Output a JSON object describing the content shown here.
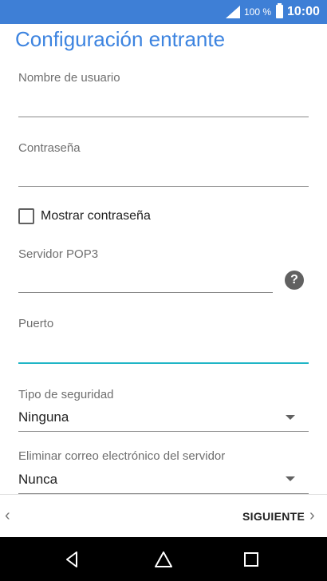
{
  "status_bar": {
    "battery_percent": "100 %",
    "time": "10:00",
    "signal_icon": "signal-icon",
    "battery_icon": "battery-icon"
  },
  "page": {
    "title": "Configuración entrante"
  },
  "form": {
    "username_label": "Nombre de usuario",
    "username_value": "",
    "password_label": "Contraseña",
    "password_value": "",
    "show_password_label": "Mostrar contraseña",
    "show_password_checked": false,
    "server_label": "Servidor POP3",
    "server_value": "",
    "help_icon": "help-icon",
    "port_label": "Puerto",
    "port_value": "",
    "security_label": "Tipo de seguridad",
    "security_value": "Ninguna",
    "delete_label": "Eliminar correo electrónico del servidor",
    "delete_value": "Nunca"
  },
  "footer": {
    "next_label": "SIGUIENTE"
  },
  "colors": {
    "status_bar": "#3e7fd6",
    "title": "#3d84e0",
    "active_field": "#1fb5c6"
  }
}
